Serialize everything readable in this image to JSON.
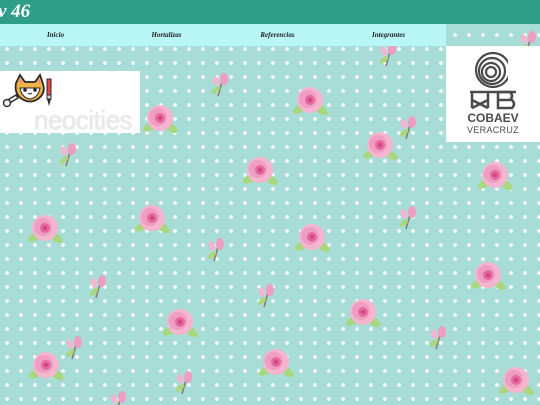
{
  "header": {
    "title": "v 46"
  },
  "nav": {
    "items": [
      {
        "label": "Inicio"
      },
      {
        "label": "Hortalizas"
      },
      {
        "label": "Referencias"
      },
      {
        "label": "Integrantes"
      }
    ]
  },
  "badge": {
    "text": "neocities",
    "icon": "neocities-cat-icon"
  },
  "logo": {
    "name": "COBAEV",
    "state": "VERACRUZ",
    "icon": "cobaev-spiral-icon"
  },
  "colors": {
    "header": "#2f9e89",
    "nav": "#b9f6f6",
    "background": "#a7dcd7",
    "petal": "#f2a3c3",
    "leaf": "#a8d77e"
  }
}
